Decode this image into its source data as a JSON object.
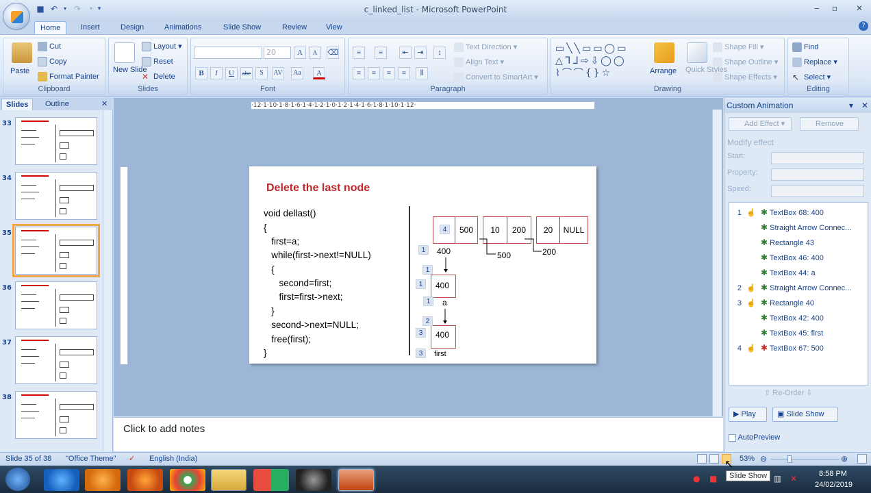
{
  "window": {
    "title": "c_linked_list - Microsoft PowerPoint"
  },
  "tabs": [
    "Home",
    "Insert",
    "Design",
    "Animations",
    "Slide Show",
    "Review",
    "View"
  ],
  "ribbon": {
    "clipboard": {
      "label": "Clipboard",
      "paste": "Paste",
      "cut": "Cut",
      "copy": "Copy",
      "format_painter": "Format Painter"
    },
    "slides": {
      "label": "Slides",
      "new_slide": "New Slide",
      "layout": "Layout",
      "reset": "Reset",
      "delete": "Delete"
    },
    "font": {
      "label": "Font",
      "size": "20"
    },
    "paragraph": {
      "label": "Paragraph",
      "text_direction": "Text Direction",
      "align_text": "Align Text",
      "convert": "Convert to SmartArt"
    },
    "drawing": {
      "label": "Drawing",
      "arrange": "Arrange",
      "quick_styles": "Quick Styles",
      "shape_fill": "Shape Fill",
      "shape_outline": "Shape Outline",
      "shape_effects": "Shape Effects"
    },
    "editing": {
      "label": "Editing",
      "find": "Find",
      "replace": "Replace",
      "select": "Select"
    }
  },
  "left_panel": {
    "tab_slides": "Slides",
    "tab_outline": "Outline",
    "thumbs": [
      "33",
      "34",
      "35",
      "36",
      "37",
      "38"
    ]
  },
  "slide": {
    "title": "Delete the last node",
    "code": [
      "void dellast()",
      "{",
      "   first=a;",
      "   while(first->next!=NULL)",
      "   {",
      "      second=first;",
      "      first=first->next;",
      "   }",
      "   second->next=NULL;",
      "   free(first);",
      "}"
    ],
    "nodes": [
      [
        "4",
        "500"
      ],
      [
        "10",
        "200"
      ],
      [
        "20",
        "NULL"
      ]
    ],
    "labels": {
      "n400": "400",
      "p500": "500",
      "p200": "200",
      "b400a": "400",
      "a": "a",
      "b400b": "400",
      "first": "first"
    },
    "anim_badges": {
      "b4": "4",
      "b1a": "1",
      "b1b": "1",
      "b1c": "1",
      "b1d": "1",
      "b2": "2",
      "b3a": "3",
      "b3b": "3"
    }
  },
  "ruler": "·12·1·10·1·8·1·6·1·4·1·2·1·0·1·2·1·4·1·6·1·8·1·10·1·12·",
  "notes": "Click to add notes",
  "task_pane": {
    "title": "Custom Animation",
    "add_effect": "Add Effect",
    "remove": "Remove",
    "modify": "Modify effect",
    "start": "Start:",
    "property": "Property:",
    "speed": "Speed:",
    "items": [
      {
        "num": "1",
        "name": "TextBox 68: 400",
        "star": "green"
      },
      {
        "num": "",
        "name": "Straight Arrow Connec...",
        "star": "green"
      },
      {
        "num": "",
        "name": "Rectangle 43",
        "star": "green"
      },
      {
        "num": "",
        "name": "TextBox 46: 400",
        "star": "green"
      },
      {
        "num": "",
        "name": "TextBox 44: a",
        "star": "green"
      },
      {
        "num": "2",
        "name": "Straight Arrow Connec...",
        "star": "green"
      },
      {
        "num": "3",
        "name": "Rectangle 40",
        "star": "green"
      },
      {
        "num": "",
        "name": "TextBox 42: 400",
        "star": "green"
      },
      {
        "num": "",
        "name": "TextBox 45: first",
        "star": "green"
      },
      {
        "num": "4",
        "name": "TextBox 67: 500",
        "star": "red"
      }
    ],
    "reorder": "Re-Order",
    "play": "Play",
    "slide_show": "Slide Show",
    "autopreview": "AutoPreview"
  },
  "status": {
    "slide": "Slide 35 of 38",
    "theme": "\"Office Theme\"",
    "language": "English (India)",
    "zoom": "53%"
  },
  "tooltip": "Slide Show",
  "clock": {
    "time": "8:58 PM",
    "date": "24/02/2019"
  }
}
